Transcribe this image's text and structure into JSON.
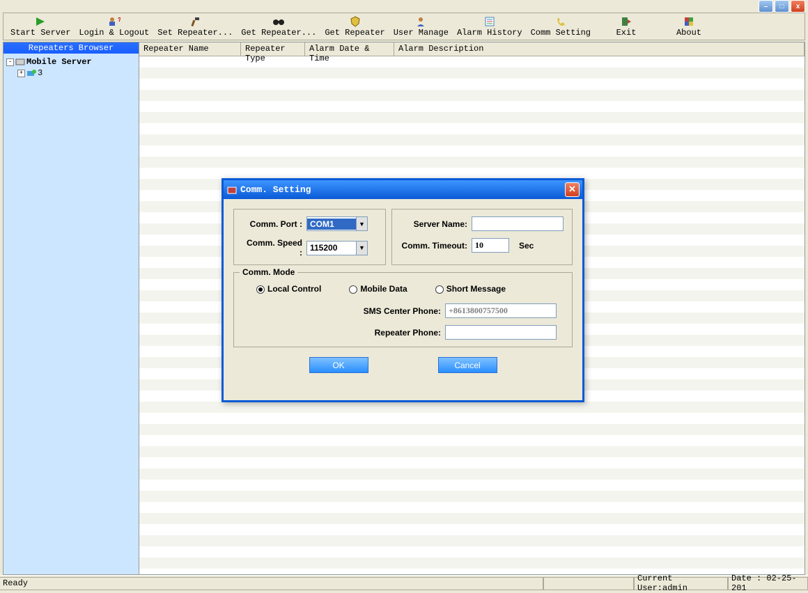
{
  "titlebar": {
    "minimize": "–",
    "maximize": "□",
    "close": "x"
  },
  "toolbar": [
    {
      "label": "Start Server",
      "icon": "play"
    },
    {
      "label": "Login & Logout",
      "icon": "people"
    },
    {
      "label": "Set Repeater...",
      "icon": "hammer"
    },
    {
      "label": "Get Repeater...",
      "icon": "binoc"
    },
    {
      "label": "Get Repeater",
      "icon": "shield"
    },
    {
      "label": "User Manage",
      "icon": "user"
    },
    {
      "label": "Alarm History",
      "icon": "list"
    },
    {
      "label": "Comm Setting",
      "icon": "phone"
    },
    {
      "label": "Exit",
      "icon": "exit"
    },
    {
      "label": "About",
      "icon": "flag"
    }
  ],
  "sidebar": {
    "header": "Repeaters Browser",
    "root": "Mobile Server",
    "child": "3"
  },
  "columns": [
    "Repeater Name",
    "Repeater Type",
    "Alarm Date & Time",
    "Alarm Description"
  ],
  "status": {
    "ready": "Ready",
    "user": "Current User:admin",
    "date": "Date : 02-25-201"
  },
  "dialog": {
    "title": "Comm. Setting",
    "comm_port_label": "Comm. Port :",
    "comm_port_value": "COM1",
    "comm_speed_label": "Comm. Speed :",
    "comm_speed_value": "115200",
    "server_name_label": "Server Name:",
    "server_name_value": "",
    "comm_timeout_label": "Comm. Timeout:",
    "comm_timeout_value": "10",
    "sec": "Sec",
    "mode_legend": "Comm. Mode",
    "mode_local": "Local Control",
    "mode_mobile": "Mobile Data",
    "mode_short": "Short Message",
    "sms_label": "SMS Center Phone:",
    "sms_value": "+8613800757500",
    "repeater_phone_label": "Repeater Phone:",
    "repeater_phone_value": "",
    "ok": "OK",
    "cancel": "Cancel"
  }
}
